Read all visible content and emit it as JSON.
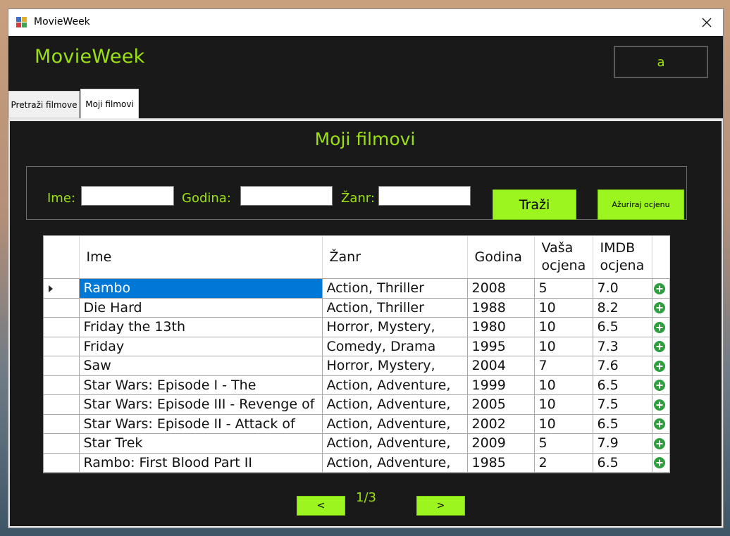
{
  "window": {
    "title": "MovieWeek"
  },
  "header": {
    "brand": "MovieWeek",
    "user": "a"
  },
  "tabs": [
    {
      "label": "Pretraži filmove",
      "active": false
    },
    {
      "label": "Moji filmovi",
      "active": true
    }
  ],
  "page": {
    "heading": "Moji filmovi"
  },
  "filters": {
    "name_label": "Ime:",
    "name_value": "",
    "year_label": "Godina:",
    "year_value": "",
    "genre_label": "Žanr:",
    "genre_value": "",
    "search_button": "Traži",
    "update_button": "Ažuriraj ocjenu"
  },
  "table": {
    "columns": [
      "Ime",
      "Žanr",
      "Godina",
      "Vaša ocjena",
      "IMDB ocjena"
    ],
    "rows": [
      [
        "Rambo",
        "Action, Thriller",
        "2008",
        "5",
        "7.0"
      ],
      [
        "Die Hard",
        "Action, Thriller",
        "1988",
        "10",
        "8.2"
      ],
      [
        "Friday the 13th",
        "Horror, Mystery,",
        "1980",
        "10",
        "6.5"
      ],
      [
        "Friday",
        "Comedy, Drama",
        "1995",
        "10",
        "7.3"
      ],
      [
        "Saw",
        "Horror, Mystery,",
        "2004",
        "7",
        "7.6"
      ],
      [
        "Star Wars: Episode I - The",
        "Action, Adventure,",
        "1999",
        "10",
        "6.5"
      ],
      [
        "Star Wars: Episode III - Revenge of",
        "Action, Adventure,",
        "2005",
        "10",
        "7.5"
      ],
      [
        "Star Wars: Episode II - Attack of",
        "Action, Adventure,",
        "2002",
        "10",
        "6.5"
      ],
      [
        "Star Trek",
        "Action, Adventure,",
        "2009",
        "5",
        "7.9"
      ],
      [
        "Rambo: First Blood Part II",
        "Action, Adventure,",
        "1985",
        "2",
        "6.5"
      ]
    ],
    "selected_row": 0,
    "row_action_icon": "plus-circle-icon"
  },
  "pager": {
    "prev": "<",
    "page": "1/3",
    "next": ">"
  },
  "colors": {
    "accent": "#9be10f",
    "button": "#9cf51e",
    "background": "#191919",
    "selection": "#0078d7",
    "plus": "#2e9e3e"
  }
}
